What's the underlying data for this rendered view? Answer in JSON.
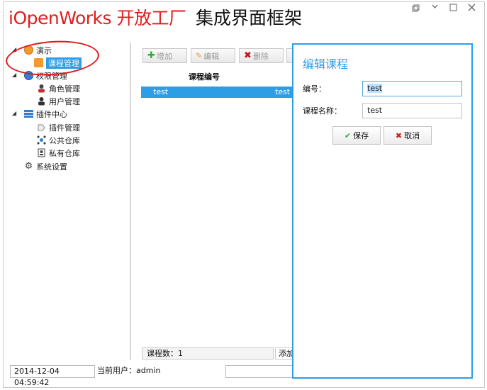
{
  "app": {
    "title_en": "iOpenWorks 开放工厂",
    "title_zh": "集成界面框架",
    "window_buttons": [
      "restore-icon",
      "minimize-icon",
      "maximize-icon",
      "close-icon"
    ]
  },
  "sidebar": {
    "items": [
      {
        "label": "演示",
        "icon": "demo-icon"
      },
      {
        "label": "课程管理",
        "icon": "course-icon"
      },
      {
        "label": "权限管理",
        "icon": "permission-icon"
      },
      {
        "label": "角色管理",
        "icon": "role-icon"
      },
      {
        "label": "用户管理",
        "icon": "user-icon"
      },
      {
        "label": "插件中心",
        "icon": "plugin-center-icon"
      },
      {
        "label": "插件管理",
        "icon": "plugin-icon"
      },
      {
        "label": "公共仓库",
        "icon": "public-repo-icon"
      },
      {
        "label": "私有仓库",
        "icon": "private-repo-icon"
      },
      {
        "label": "系统设置",
        "icon": "gear-icon"
      }
    ]
  },
  "toolbar": {
    "add_label": "增加",
    "edit_label": "编辑",
    "delete_label": "删除"
  },
  "grid": {
    "column_header": "课程编号",
    "rows": [
      {
        "code": "test",
        "name": "test"
      }
    ]
  },
  "footer": {
    "count": "课程数：1",
    "add": "添加"
  },
  "status": {
    "time": "2014-12-04 04:59:42",
    "user": "当前用户：admin"
  },
  "dialog": {
    "title": "编辑课程",
    "code_label": "编号：",
    "code_value": "test",
    "name_label": "课程名称：",
    "name_value": "test",
    "save_label": "保存",
    "cancel_label": "取消"
  },
  "colors": {
    "accent": "#2d9ee6",
    "title_red": "#e21d1d",
    "annotation_red": "#e01919"
  }
}
